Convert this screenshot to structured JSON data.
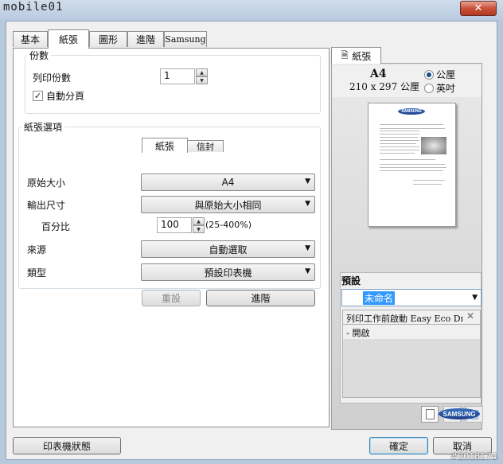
{
  "watermark": "mobile01",
  "window": {
    "close_glyph": "✕"
  },
  "tabs": [
    {
      "label": "基本"
    },
    {
      "label": "紙張"
    },
    {
      "label": "圖形"
    },
    {
      "label": "進階"
    },
    {
      "label": "Samsung"
    }
  ],
  "copies": {
    "group_title": "份數",
    "label": "列印份數",
    "value": "1",
    "collate_label": "自動分頁",
    "collate_check": "✓"
  },
  "paper": {
    "group_title": "紙張選項",
    "subtabs": [
      {
        "label": "紙張"
      },
      {
        "label": "信封"
      }
    ],
    "original_size_label": "原始大小",
    "original_size_value": "A4",
    "output_size_label": "輸出尺寸",
    "output_size_value": "與原始大小相同",
    "percent_label": "百分比",
    "percent_value": "100",
    "percent_range": "(25-400%)",
    "source_label": "來源",
    "source_value": "自動選取",
    "type_label": "類型",
    "type_value": "預設印表機",
    "reset_button": "重設",
    "advanced_button": "進階"
  },
  "preview": {
    "tab_label": "紙張",
    "paper_name": "A4",
    "paper_dims": "210 x 297 公厘",
    "unit_metric": "公厘",
    "unit_imperial": "英吋",
    "selected_unit": "metric"
  },
  "presets": {
    "title": "預設",
    "value": "未命名",
    "item_title": "列印工作前啟動 Easy Eco Dri...",
    "item_detail": "- 開啟"
  },
  "footer": {
    "printer_status": "印表機狀態",
    "ok": "確定",
    "cancel": "取消"
  },
  "brand": "SAMSUNG",
  "photo_id": "#2018174",
  "colors": {
    "accent": "#3399ff",
    "selection": "#3399ff",
    "samsung_blue": "#1a3e8a"
  }
}
